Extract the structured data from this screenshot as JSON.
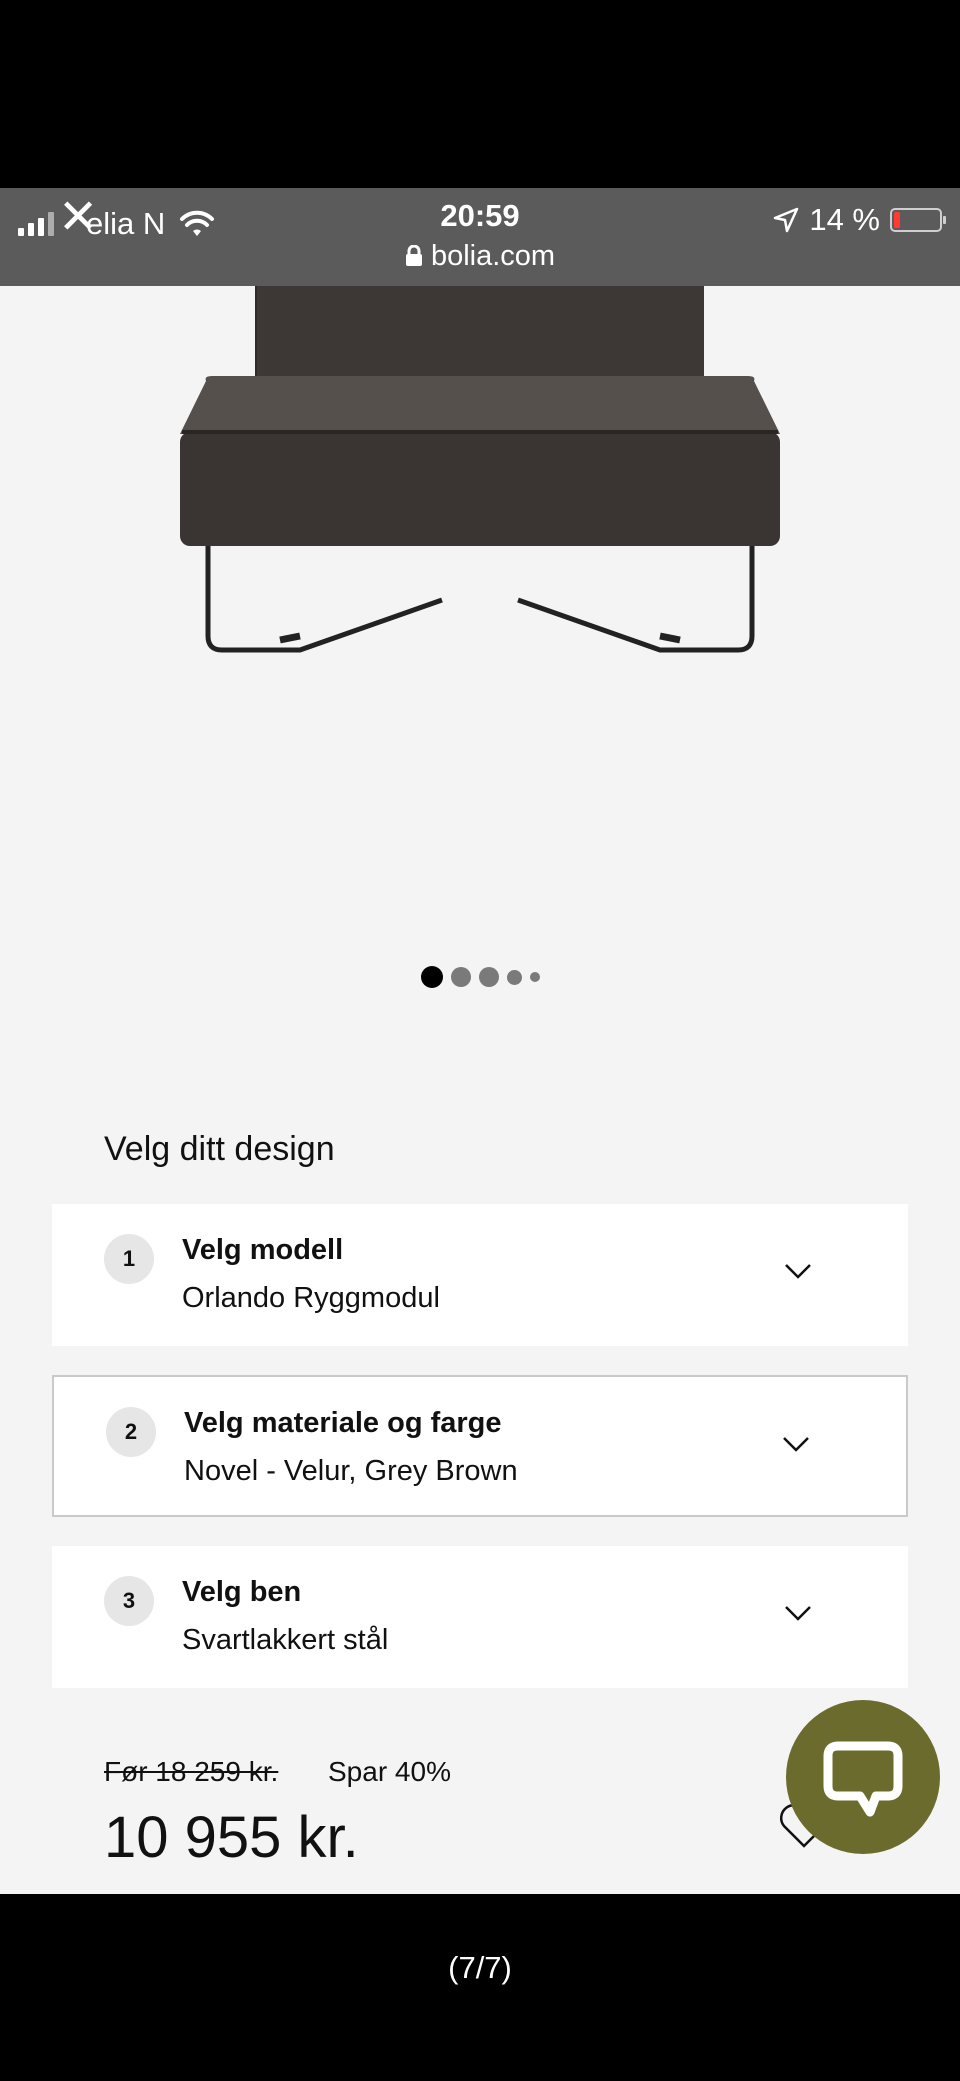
{
  "status_bar": {
    "carrier": "elia N",
    "time": "20:59",
    "url": "bolia.com",
    "battery": "14 %",
    "battery_level": 0.14
  },
  "gallery": {
    "dot_count": 5,
    "active_index": 0
  },
  "design": {
    "title": "Velg ditt design",
    "steps": [
      {
        "number": "1",
        "title": "Velg modell",
        "value": "Orlando Ryggmodul"
      },
      {
        "number": "2",
        "title": "Velg materiale og farge",
        "value": "Novel - Velur, Grey Brown"
      },
      {
        "number": "3",
        "title": "Velg ben",
        "value": "Svartlakkert stål"
      }
    ]
  },
  "pricing": {
    "old_price": "Før 18 259 kr.",
    "savings": "Spar 40%",
    "price": "10 955 kr."
  },
  "viewer": {
    "counter": "(7/7)"
  },
  "colors": {
    "status_bar_bg": "#5b5b5b",
    "page_bg": "#f4f4f4",
    "chat_button": "#6b6b2e",
    "battery_low": "#ff3b30"
  }
}
